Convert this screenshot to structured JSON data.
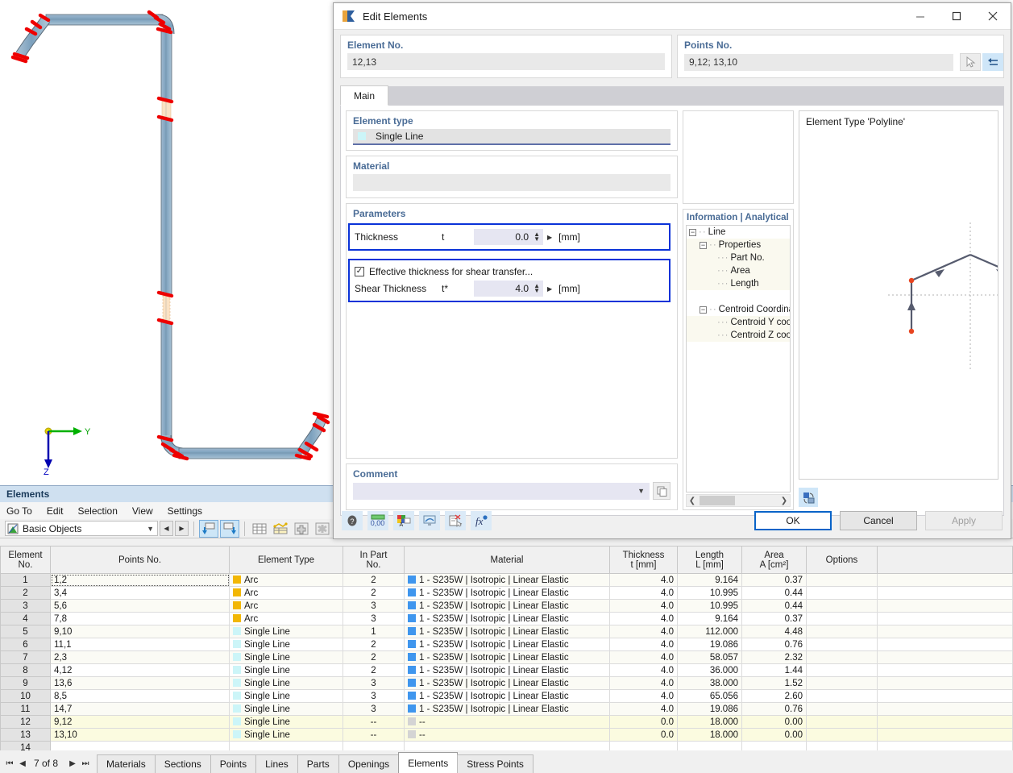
{
  "viewport": {
    "axis_y_label": "Y",
    "axis_z_label": "Z"
  },
  "elements_panel": {
    "title": "Elements",
    "menus": [
      "Go To",
      "Edit",
      "Selection",
      "View",
      "Settings"
    ],
    "object_filter": "Basic Objects",
    "page_status": "7 of 8",
    "sheet_tabs": [
      {
        "label": "Materials",
        "selected": false
      },
      {
        "label": "Sections",
        "selected": false
      },
      {
        "label": "Points",
        "selected": false
      },
      {
        "label": "Lines",
        "selected": false
      },
      {
        "label": "Parts",
        "selected": false
      },
      {
        "label": "Openings",
        "selected": false
      },
      {
        "label": "Elements",
        "selected": true
      },
      {
        "label": "Stress Points",
        "selected": false
      }
    ],
    "table": {
      "columns": [
        {
          "key": "no",
          "header_line1": "Element",
          "header_line2": "No."
        },
        {
          "key": "points",
          "header_line1": "Points No.",
          "header_line2": ""
        },
        {
          "key": "etype",
          "header_line1": "Element Type",
          "header_line2": ""
        },
        {
          "key": "part",
          "header_line1": "In Part",
          "header_line2": "No."
        },
        {
          "key": "material",
          "header_line1": "Material",
          "header_line2": ""
        },
        {
          "key": "thickness",
          "header_line1": "Thickness",
          "header_line2": "t [mm]"
        },
        {
          "key": "length",
          "header_line1": "Length",
          "header_line2": "L [mm]"
        },
        {
          "key": "area",
          "header_line1": "Area",
          "header_line2": "A [cm²]"
        },
        {
          "key": "options",
          "header_line1": "Options",
          "header_line2": ""
        },
        {
          "key": "spare",
          "header_line1": "",
          "header_line2": ""
        }
      ],
      "rows": [
        {
          "no": "1",
          "points": "1,2",
          "etype": "Arc",
          "part": "2",
          "material": "1 - S235W | Isotropic | Linear Elastic",
          "thickness": "4.0",
          "length": "9.164",
          "area": "0.37",
          "options": "",
          "selected": false,
          "focus": true
        },
        {
          "no": "2",
          "points": "3,4",
          "etype": "Arc",
          "part": "2",
          "material": "1 - S235W | Isotropic | Linear Elastic",
          "thickness": "4.0",
          "length": "10.995",
          "area": "0.44",
          "options": "",
          "selected": false
        },
        {
          "no": "3",
          "points": "5,6",
          "etype": "Arc",
          "part": "3",
          "material": "1 - S235W | Isotropic | Linear Elastic",
          "thickness": "4.0",
          "length": "10.995",
          "area": "0.44",
          "options": "",
          "selected": false
        },
        {
          "no": "4",
          "points": "7,8",
          "etype": "Arc",
          "part": "3",
          "material": "1 - S235W | Isotropic | Linear Elastic",
          "thickness": "4.0",
          "length": "9.164",
          "area": "0.37",
          "options": "",
          "selected": false
        },
        {
          "no": "5",
          "points": "9,10",
          "etype": "Single Line",
          "part": "1",
          "material": "1 - S235W | Isotropic | Linear Elastic",
          "thickness": "4.0",
          "length": "112.000",
          "area": "4.48",
          "options": "",
          "selected": false
        },
        {
          "no": "6",
          "points": "11,1",
          "etype": "Single Line",
          "part": "2",
          "material": "1 - S235W | Isotropic | Linear Elastic",
          "thickness": "4.0",
          "length": "19.086",
          "area": "0.76",
          "options": "",
          "selected": false
        },
        {
          "no": "7",
          "points": "2,3",
          "etype": "Single Line",
          "part": "2",
          "material": "1 - S235W | Isotropic | Linear Elastic",
          "thickness": "4.0",
          "length": "58.057",
          "area": "2.32",
          "options": "",
          "selected": false
        },
        {
          "no": "8",
          "points": "4,12",
          "etype": "Single Line",
          "part": "2",
          "material": "1 - S235W | Isotropic | Linear Elastic",
          "thickness": "4.0",
          "length": "36.000",
          "area": "1.44",
          "options": "",
          "selected": false
        },
        {
          "no": "9",
          "points": "13,6",
          "etype": "Single Line",
          "part": "3",
          "material": "1 - S235W | Isotropic | Linear Elastic",
          "thickness": "4.0",
          "length": "38.000",
          "area": "1.52",
          "options": "",
          "selected": false
        },
        {
          "no": "10",
          "points": "8,5",
          "etype": "Single Line",
          "part": "3",
          "material": "1 - S235W | Isotropic | Linear Elastic",
          "thickness": "4.0",
          "length": "65.056",
          "area": "2.60",
          "options": "",
          "selected": false
        },
        {
          "no": "11",
          "points": "14,7",
          "etype": "Single Line",
          "part": "3",
          "material": "1 - S235W | Isotropic | Linear Elastic",
          "thickness": "4.0",
          "length": "19.086",
          "area": "0.76",
          "options": "",
          "selected": false
        },
        {
          "no": "12",
          "points": "9,12",
          "etype": "Single Line",
          "part": "--",
          "material": "--",
          "thickness": "0.0",
          "length": "18.000",
          "area": "0.00",
          "options": "",
          "selected": true
        },
        {
          "no": "13",
          "points": "13,10",
          "etype": "Single Line",
          "part": "--",
          "material": "--",
          "thickness": "0.0",
          "length": "18.000",
          "area": "0.00",
          "options": "",
          "selected": true
        },
        {
          "no": "14",
          "points": "",
          "etype": "",
          "part": "",
          "material": "",
          "thickness": "",
          "length": "",
          "area": "",
          "options": "",
          "selected": false
        }
      ]
    }
  },
  "dialog": {
    "title": "Edit Elements",
    "window_buttons": {
      "minimize": "—",
      "maximize": "☐",
      "close": "✕"
    },
    "element_no": {
      "label": "Element No.",
      "value": "12,13"
    },
    "points_no": {
      "label": "Points No.",
      "value": "9,12; 13,10"
    },
    "tabs": [
      {
        "label": "Main",
        "selected": true
      }
    ],
    "element_type": {
      "label": "Element type",
      "value": "Single Line"
    },
    "material": {
      "label": "Material",
      "value": ""
    },
    "parameters": {
      "label": "Parameters",
      "thickness": {
        "name": "Thickness",
        "symbol": "t",
        "value": "0.0",
        "unit": "[mm]"
      },
      "effective_shear": {
        "checkbox_label": "Effective thickness for shear transfer...",
        "checked": true
      },
      "shear_thickness": {
        "name": "Shear Thickness",
        "symbol": "t*",
        "value": "4.0",
        "unit": "[mm]"
      }
    },
    "info_tree": {
      "label": "Information | Analytical",
      "nodes": [
        {
          "text": "Line",
          "depth": 0,
          "expander": "−",
          "shade": false
        },
        {
          "text": "Properties",
          "depth": 1,
          "expander": "−",
          "shade": true
        },
        {
          "text": "Part No.",
          "depth": 2,
          "expander": "",
          "shade": true
        },
        {
          "text": "Area",
          "depth": 2,
          "expander": "",
          "shade": true
        },
        {
          "text": "Length",
          "depth": 2,
          "expander": "",
          "shade": true
        },
        {
          "text": "",
          "depth": 2,
          "expander": "",
          "shade": false
        },
        {
          "text": "Centroid Coordinat",
          "depth": 1,
          "expander": "−",
          "shade": false
        },
        {
          "text": "Centroid Y coor",
          "depth": 2,
          "expander": "",
          "shade": true
        },
        {
          "text": "Centroid Z coo",
          "depth": 2,
          "expander": "",
          "shade": true
        }
      ]
    },
    "comment": {
      "label": "Comment",
      "value": "",
      "placeholder": ""
    },
    "preview": {
      "title": "Element Type 'Polyline'"
    },
    "footer": {
      "ok_label": "OK",
      "cancel_label": "Cancel",
      "apply_label": "Apply",
      "apply_disabled": true
    }
  },
  "colors": {
    "accent_blue": "#0a64c8",
    "highlight_border": "#0a32d8",
    "group_label": "#4a6c96",
    "selected_row": "#fbfbe0",
    "arc_swatch": "#f2b705",
    "line_swatch": "#ccf5f8",
    "material_swatch": "#3f96ee",
    "panel_title_bg": "#cfe0f0"
  }
}
